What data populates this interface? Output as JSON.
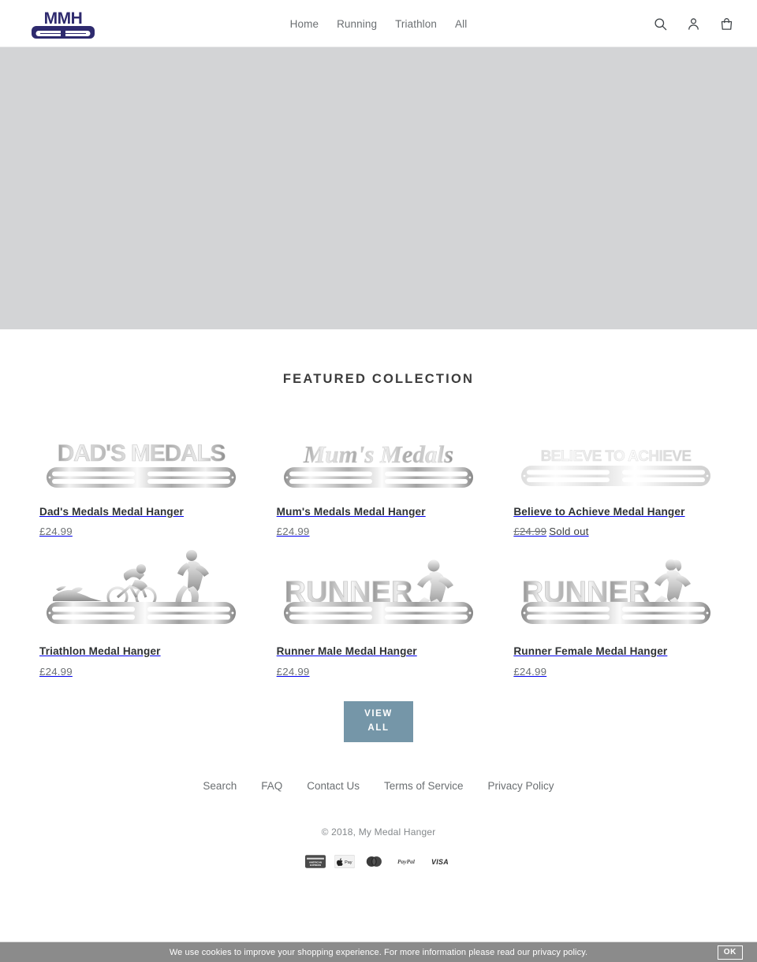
{
  "header": {
    "logo_text": "MMH",
    "logo_color": "#2e2a6e",
    "nav": [
      {
        "label": "Home"
      },
      {
        "label": "Running"
      },
      {
        "label": "Triathlon"
      },
      {
        "label": "All"
      }
    ],
    "icons": [
      {
        "name": "search-icon",
        "label": "Search"
      },
      {
        "name": "account-icon",
        "label": "Log in"
      },
      {
        "name": "cart-icon",
        "label": "Cart"
      }
    ]
  },
  "hero": {
    "background_color": "#d3d4d6"
  },
  "featured": {
    "title": "Featured collection",
    "products": [
      {
        "title": "Dad's Medals Medal Hanger",
        "price": "£24.99",
        "sold_out": false,
        "artwork_text": "DAD'S MEDALS",
        "artwork_style": "block"
      },
      {
        "title": "Mum's Medals Medal Hanger",
        "price": "£24.99",
        "sold_out": false,
        "artwork_text": "Mum's Medals",
        "artwork_style": "script"
      },
      {
        "title": "Believe to Achieve Medal Hanger",
        "price": "£24.99",
        "sold_out": true,
        "sold_out_label": "Sold out",
        "artwork_text": "BELIEVE TO ACHIEVE",
        "artwork_style": "block-light"
      },
      {
        "title": "Triathlon Medal Hanger",
        "price": "£24.99",
        "sold_out": false,
        "artwork_text": "",
        "artwork_style": "triathlon"
      },
      {
        "title": "Runner Male Medal Hanger",
        "price": "£24.99",
        "sold_out": false,
        "artwork_text": "RUNNER",
        "artwork_style": "runner-male"
      },
      {
        "title": "Runner Female Medal Hanger",
        "price": "£24.99",
        "sold_out": false,
        "artwork_text": "RUNNER",
        "artwork_style": "runner-female"
      }
    ],
    "view_all_line1": "View",
    "view_all_line2": "All",
    "view_all_color": "#7596a8"
  },
  "footer": {
    "links": [
      {
        "label": "Search"
      },
      {
        "label": "FAQ"
      },
      {
        "label": "Contact Us"
      },
      {
        "label": "Terms of Service"
      },
      {
        "label": "Privacy Policy"
      }
    ],
    "copyright": "© 2018, My Medal Hanger",
    "payment_methods": [
      {
        "name": "amex",
        "label": "American Express"
      },
      {
        "name": "apple-pay",
        "label": "Apple Pay"
      },
      {
        "name": "mastercard",
        "label": "Mastercard"
      },
      {
        "name": "paypal",
        "label": "PayPal"
      },
      {
        "name": "visa",
        "label": "VISA"
      }
    ]
  },
  "cookie_bar": {
    "message": "We use cookies to improve your shopping experience. For more information please read our privacy policy.",
    "button_label": "OK",
    "background_color": "#8b8b8b"
  }
}
